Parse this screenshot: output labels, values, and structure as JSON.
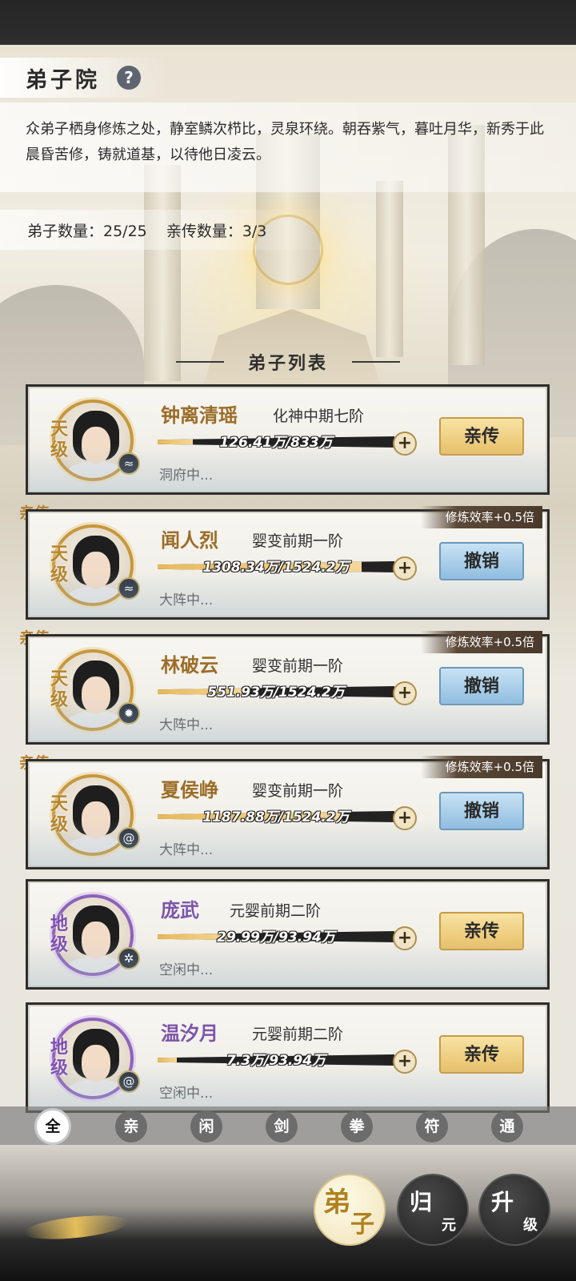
{
  "header": {
    "title": "弟子院",
    "help_icon": "?",
    "description": "众弟子栖身修炼之处，静室鳞次栉比，灵泉环绕。朝吞紫气，暮吐月华，新秀于此晨昏苦修，铸就道基，以待他日凌云。",
    "disciple_count": "弟子数量：25/25",
    "direct_count": "亲传数量：3/3"
  },
  "list_title": "弟子列表",
  "disciples": [
    {
      "name": "钟离清瑶",
      "realm": "化神中期七阶",
      "grade": "天级",
      "exp": "126.41万/833万",
      "progress": 0.15,
      "status": "洞府中...",
      "action": "亲传",
      "tag": "",
      "bonus": "",
      "element_icon": "water-icon"
    },
    {
      "name": "闻人烈",
      "realm": "婴变前期一阶",
      "grade": "天级",
      "exp": "1308.34万/1524.2万",
      "progress": 0.86,
      "status": "大阵中...",
      "action": "撤销",
      "tag": "亲传",
      "bonus": "修炼效率+0.5倍",
      "element_icon": "water-icon"
    },
    {
      "name": "林破云",
      "realm": "婴变前期一阶",
      "grade": "天级",
      "exp": "551.93万/1524.2万",
      "progress": 0.36,
      "status": "大阵中...",
      "action": "撤销",
      "tag": "亲传",
      "bonus": "修炼效率+0.5倍",
      "element_icon": "fire-icon"
    },
    {
      "name": "夏侯峥",
      "realm": "婴变前期一阶",
      "grade": "天级",
      "exp": "1187.88万/1524.2万",
      "progress": 0.78,
      "status": "大阵中...",
      "action": "撤销",
      "tag": "亲传",
      "bonus": "修炼效率+0.5倍",
      "element_icon": "swirl-icon"
    },
    {
      "name": "庞武",
      "realm": "元婴前期二阶",
      "grade": "地级",
      "exp": "29.99万/93.94万",
      "progress": 0.32,
      "status": "空闲中...",
      "action": "亲传",
      "tag": "",
      "bonus": "",
      "element_icon": "wind-icon"
    },
    {
      "name": "温汐月",
      "realm": "元婴前期二阶",
      "grade": "地级",
      "exp": "7.3万/93.94万",
      "progress": 0.08,
      "status": "空闲中...",
      "action": "亲传",
      "tag": "",
      "bonus": "",
      "element_icon": "swirl-icon"
    }
  ],
  "filter_tabs": [
    "全",
    "亲",
    "闲",
    "剑",
    "拳",
    "符",
    "通"
  ],
  "nav": {
    "disciple": [
      "弟",
      "子"
    ],
    "return": [
      "归",
      "元"
    ],
    "upgrade": [
      "升",
      "级"
    ]
  },
  "colors": {
    "gold_grade": "#b6842a",
    "purple_grade": "#7e4fb0",
    "gold_button": "#e8c068",
    "blue_button": "#8fbde0"
  }
}
